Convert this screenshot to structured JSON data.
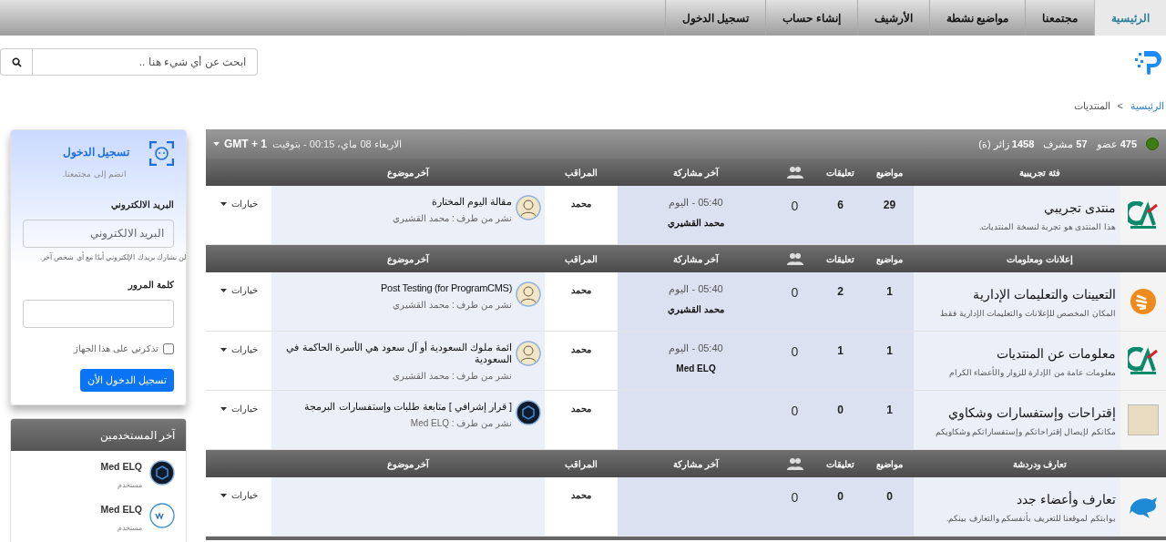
{
  "nav": {
    "tabs": [
      {
        "label": "الرئيسية",
        "selected": true
      },
      {
        "label": "مجتمعنا",
        "selected": false
      },
      {
        "label": "مواضيع نشطة",
        "selected": false
      },
      {
        "label": "الأرشيف",
        "selected": false
      },
      {
        "label": "إنشاء حساب",
        "selected": false
      },
      {
        "label": "تسجيل الدخول",
        "selected": false
      }
    ]
  },
  "search": {
    "placeholder": "ابحث عن أي شيء هنا .."
  },
  "breadcrumb": {
    "items": [
      "الرئيسية",
      "المنتديات"
    ],
    "separator": ">"
  },
  "stats": {
    "members": "**475** عضو",
    "moderators": "**57** مشرف",
    "visitors": "**1458** زائر (ة)",
    "date_line": "الاربعاء 08 ماي، 00:15 - بتوقيت",
    "timezone": "GMT + 1"
  },
  "categories": [
    {
      "title": "فئة تجريبية",
      "columns": [
        "مواضيع",
        "تعليقات",
        "آخر مشاركة",
        "المراقب",
        "آخر موضوع"
      ],
      "forums": [
        {
          "name": "منتدى تجريبي",
          "description": "هذا المنتدى هو تجربة لنسخة المنتديات.",
          "topics": "29",
          "comments": "6",
          "users": "0",
          "last_post": {
            "time": "05:40 - اليوم",
            "author": "محمد القشيري"
          },
          "moderator": "محمد",
          "last_topic": {
            "title": "مقالة اليوم المختارة",
            "by": "نشر من طرف : محمد القشيري"
          },
          "options": "خيارات"
        }
      ]
    },
    {
      "title": "إعلانات ومعلومات",
      "columns": [
        "مواضيع",
        "تعليقات",
        "آخر مشاركة",
        "المراقب",
        "آخر موضوع"
      ],
      "forums": [
        {
          "name": "التعيينات والتعليمات الإدارية",
          "description": "المكان المخصص للإعلانات والتعليمات الإدارية فقط",
          "topics": "1",
          "comments": "2",
          "users": "0",
          "last_post": {
            "time": "05:40 - اليوم",
            "author": "محمد القشيري"
          },
          "moderator": "محمد",
          "last_topic": {
            "title": "Post Testing (for ProgramCMS)",
            "by": "نشر من طرف : محمد القشيري"
          },
          "options": "خيارات"
        },
        {
          "name": "معلومات عن المنتديات",
          "description": "معلومات عامة من الإدارة للزوار والأعضاء الكرام",
          "topics": "1",
          "comments": "1",
          "users": "0",
          "last_post": {
            "time": "05:40 - اليوم",
            "author": "Med ELQ"
          },
          "moderator": "محمد",
          "last_topic": {
            "title": "ائمة ملوك السعودية أو آل سعود هي الأسرة الحاكمة في السعودية",
            "by": "نشر من طرف : محمد القشيري"
          },
          "options": "خيارات"
        },
        {
          "name": "إقتراحات وإستفسارات وشكاوي",
          "description": "مكانكم لإيصال إقتراحاتكم وإستفساراتكم وشكاويكم",
          "topics": "1",
          "comments": "0",
          "users": "0",
          "moderator": "محمد",
          "last_topic": {
            "title": "[ قرار إشرافي ] متابعة طلبات وإستفسارات البرمجة",
            "by": "نشر من طرف : Med ELQ"
          },
          "options": "خيارات"
        }
      ]
    },
    {
      "title": "تعارف ودردشة",
      "columns": [
        "مواضيع",
        "تعليقات",
        "آخر مشاركة",
        "المراقب",
        "آخر موضوع"
      ],
      "forums": [
        {
          "name": "تعارف وأعضاء جدد",
          "description": "بوابتكم لموقعنا للتعريف بأنفسكم والتعارف بينكم.",
          "topics": "0",
          "comments": "0",
          "users": "0",
          "moderator": "محمد",
          "options": "خيارات"
        }
      ]
    }
  ],
  "login": {
    "title": "تسجيل الدخول",
    "subtitle": "انضم إلى مجتمعنا.",
    "email_label": "البريد الالكتروني",
    "email_placeholder": "البريد الالكتروني",
    "email_hint": "لن نشارك بريدك الإلكتروني أبدًا مع أي شخص آخر.",
    "password_label": "كلمة المرور",
    "remember": {
      "label": "تذكرني على هذا الجهاز",
      "checked": false
    },
    "submit": "تسجيل الدخول الأن"
  },
  "latest_users": {
    "title": "آخر المستخدمين",
    "users": [
      {
        "name": "Med ELQ",
        "role": "مستخدم"
      },
      {
        "name": "Med ELQ",
        "role": "مستخدم"
      }
    ]
  }
}
